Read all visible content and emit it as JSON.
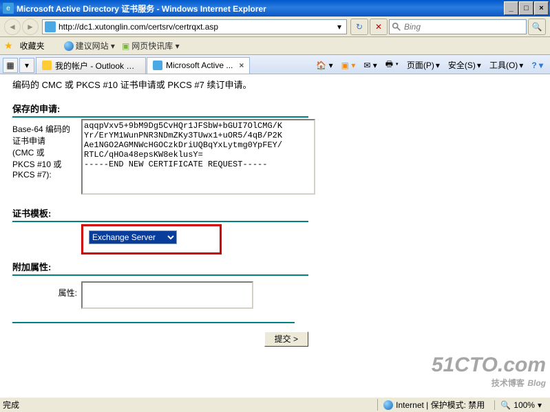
{
  "window": {
    "title": "Microsoft Active Directory 证书服务 - Windows Internet Explorer",
    "min": "_",
    "max": "□",
    "close": "×"
  },
  "nav": {
    "url": "http://dc1.xutonglin.com/certsrv/certrqxt.asp",
    "search_placeholder": "Bing",
    "refresh": "↻",
    "stop": "✕"
  },
  "fav": {
    "label": "收藏夹",
    "links": [
      "建议网站 ▾",
      "网页快讯库 ▾"
    ]
  },
  "tabs": {
    "items": [
      {
        "label": "我的帐户 - Outlook W..."
      },
      {
        "label": "Microsoft Active ..."
      }
    ]
  },
  "menu": {
    "items": [
      "页面(P)",
      "安全(S)",
      "工具(O)"
    ]
  },
  "page": {
    "desc_partial": "编码的 CMC 或 PKCS #10 证书申请或 PKCS #7 续订申请。",
    "saved_header": "保存的申请:",
    "base64_label": "Base-64 编码的\n证书申请\n(CMC 或\nPKCS #10 或\nPKCS #7):",
    "cert_request": "aqqpVxv5+9bM9Dg5CvHQr1JFSbW+bGUI7OlCMG/K\nYr/ErYM1WunPNR3NDmZKy3TUwx1+uOR5/4qB/P2K\nAe1NGO2AGMNWcHGOCzkDriUQBqYxLytmg0YpFEY/\nRTLC/qHOa48epsKW8eklusY=\n-----END NEW CERTIFICATE REQUEST-----",
    "template_header": "证书模板:",
    "template_value": "Exchange Server",
    "attr_header": "附加属性:",
    "attr_label": "属性:",
    "submit": "提交 >"
  },
  "status": {
    "done": "完成",
    "zone": "Internet | 保护模式: 禁用",
    "zoom": "100%"
  },
  "watermark": {
    "big": "51CTO.com",
    "sm": "技术博客",
    "blog": "Blog"
  }
}
